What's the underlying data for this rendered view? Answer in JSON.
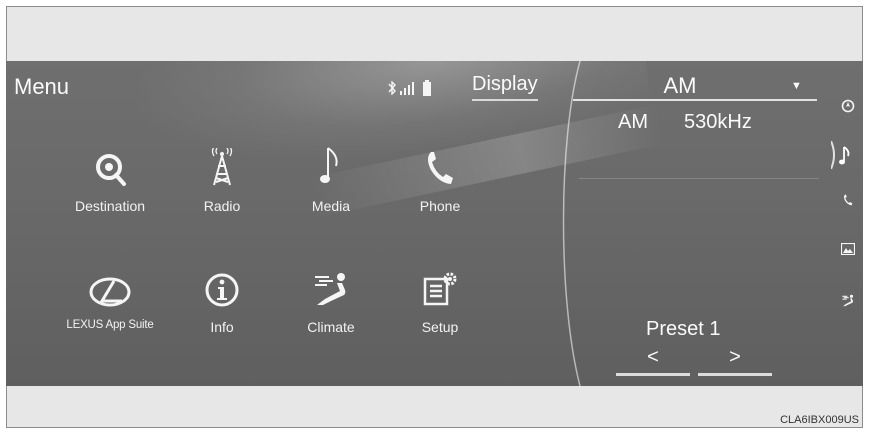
{
  "header": {
    "menu_title": "Menu",
    "display_label": "Display",
    "status_icons": [
      "bluetooth-icon",
      "signal-icon",
      "battery-icon"
    ]
  },
  "menu": {
    "items": [
      {
        "label": "Destination",
        "icon": "destination-icon"
      },
      {
        "label": "Radio",
        "icon": "radio-tower-icon"
      },
      {
        "label": "Media",
        "icon": "music-note-icon"
      },
      {
        "label": "Phone",
        "icon": "phone-icon"
      },
      {
        "label": "LEXUS App Suite",
        "icon": "lexus-logo-icon"
      },
      {
        "label": "Info",
        "icon": "info-icon"
      },
      {
        "label": "Climate",
        "icon": "climate-icon"
      },
      {
        "label": "Setup",
        "icon": "setup-icon"
      }
    ]
  },
  "radio": {
    "source": "AM",
    "dropdown_arrow": "▼",
    "band": "AM",
    "frequency": "530kHz",
    "preset_label": "Preset 1",
    "prev_symbol": "<",
    "next_symbol": ">"
  },
  "side_nav": {
    "items": [
      "navigation-icon",
      "music-note-icon",
      "phone-icon",
      "picture-icon",
      "climate-icon"
    ],
    "active": "music-note-icon"
  },
  "footer": {
    "code": "CLA6IBX009US"
  },
  "colors": {
    "screen_bg": "#686868",
    "text": "#fafafa",
    "frame_bg": "#e7e7e7"
  }
}
